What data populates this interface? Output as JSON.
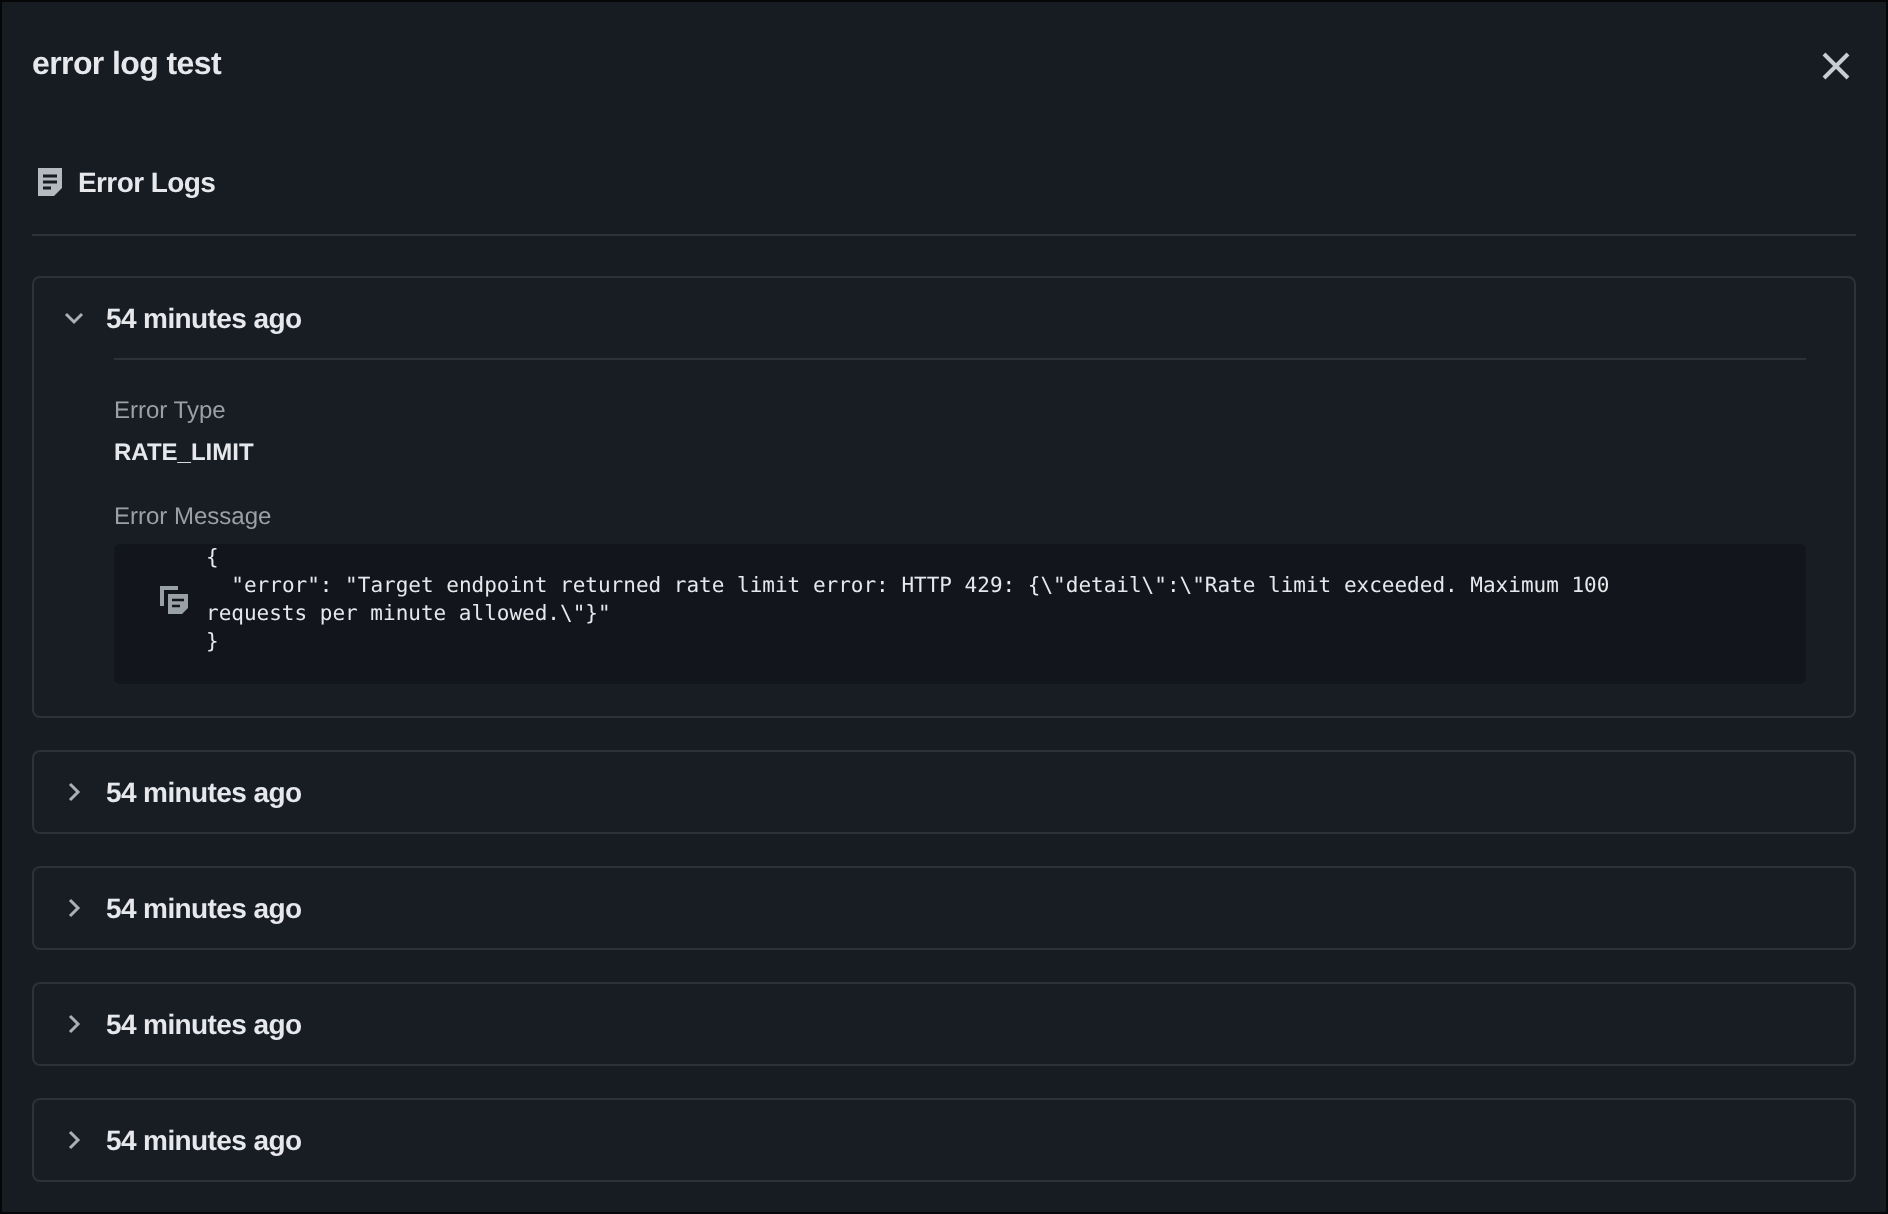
{
  "dialog": {
    "title": "error log test"
  },
  "section": {
    "title": "Error Logs"
  },
  "logs": [
    {
      "time": "54 minutes ago",
      "expanded": true,
      "error_type_label": "Error Type",
      "error_type": "RATE_LIMIT",
      "error_message_label": "Error Message",
      "error_message": "{\n  \"error\": \"Target endpoint returned rate limit error: HTTP 429: {\\\"detail\\\":\\\"Rate limit exceeded. Maximum 100 requests per minute allowed.\\\"}\"\n}"
    },
    {
      "time": "54 minutes ago",
      "expanded": false
    },
    {
      "time": "54 minutes ago",
      "expanded": false
    },
    {
      "time": "54 minutes ago",
      "expanded": false
    },
    {
      "time": "54 minutes ago",
      "expanded": false
    }
  ]
}
